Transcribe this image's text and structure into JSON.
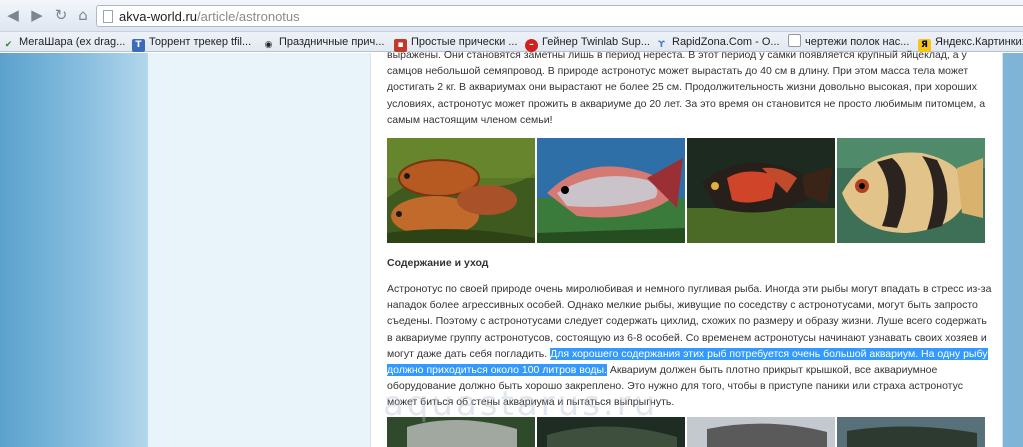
{
  "browser": {
    "corner_label": "",
    "url_host": "akva-world.ru",
    "url_path": "/article/astronotus"
  },
  "bookmarks": [
    {
      "label": "МегаШара (ex drag...",
      "icon": "checkmark-favicon",
      "color": "#2e8b2e"
    },
    {
      "label": "Торрент трекер tfil...",
      "icon": "tfile-favicon",
      "color": "#3a6cb8"
    },
    {
      "label": "Праздничные прич...",
      "icon": "eye-favicon",
      "color": "#222222"
    },
    {
      "label": "Простые прически ...",
      "icon": "hair-favicon",
      "color": "#c0392b"
    },
    {
      "label": "Гейнер Twinlab Sup...",
      "icon": "no-entry-favicon",
      "color": "#d21f1f"
    },
    {
      "label": "RapidZona.Com - O...",
      "icon": "rapidzona-favicon",
      "color": "#4a7ec0"
    },
    {
      "label": "чертежи полок нас...",
      "icon": "document-favicon",
      "color": "#ffffff"
    },
    {
      "label": "Яндекс.Картинки:...",
      "icon": "yandex-favicon",
      "color": "#f5c518"
    }
  ],
  "article": {
    "para1": "выражены. Они становятся заметны лишь в период нереста. В этот период у самки появляется крупный яйцеклад, а у самцов небольшой семяпровод. В природе астронотус может вырастать до 40 см в длину. При этом  масса тела может достигать 2 кг. В аквариумах они вырастают не более 25 см. Продолжительность жизни довольно высокая, при хороших условиях, астронотус может прожить в аквариуме до 20 лет. За это время он становится не просто любимым питомцем, а самым настоящим членом семьи!",
    "heading": "Содержание и уход",
    "para2_a": "Астронотус по своей природе очень миролюбивая и немного пугливая рыба. Иногда эти рыбы могут впадать в стресс из-за нападок более агрессивных особей. Однако мелкие рыбы, живущие по соседству с астронотусами, могут быть запросто съедены. Поэтому с астронотусами следует содержать цихлид, схожих по размеру и образу жизни. Луше всего содержать в аквариуме группу астронотусов, состоящую из 6-8  особей. Со временем астронотусы начинают узнавать своих хозяев и могут даже дать себя погладить. ",
    "para2_highlight": "Для хорошего содержания этих рыб потребуется очень большой аквариум. На одну рыбу должно приходиться около 100 литров воды.",
    "para2_b": " Аквариум должен быть плотно прикрыт крышкой, все аквариумное оборудование должно быть хорошо закреплено. Это нужно для того, чтобы в приступе паники или страха астронотус может биться об стены аквариума и пытаться выпрыгнуть.",
    "watermark": "aquastarus.ru"
  },
  "colors": {
    "selection": "#3399ff",
    "sidebar_blue": "#5aa2cd",
    "sidebar_light": "#e9f3fa"
  }
}
